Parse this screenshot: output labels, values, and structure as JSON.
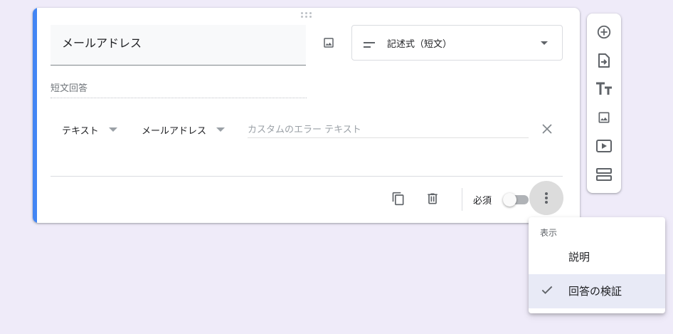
{
  "question": {
    "title": "メールアドレス",
    "type_label": "記述式（短文）",
    "answer_placeholder": "短文回答"
  },
  "validation": {
    "type": "テキスト",
    "condition": "メールアドレス",
    "error_placeholder": "カスタムのエラー テキスト"
  },
  "footer": {
    "required_label": "必須",
    "required_on": false
  },
  "menu": {
    "header": "表示",
    "items": [
      {
        "label": "説明",
        "checked": false
      },
      {
        "label": "回答の検証",
        "checked": true
      }
    ]
  },
  "toolbar": {
    "icons": [
      "add-question-icon",
      "import-questions-icon",
      "add-title-icon",
      "add-image-icon",
      "add-video-icon",
      "add-section-icon"
    ]
  },
  "colors": {
    "accent": "#4285f4",
    "background": "#efebf9",
    "selected_menu_bg": "#e8eaf6"
  }
}
